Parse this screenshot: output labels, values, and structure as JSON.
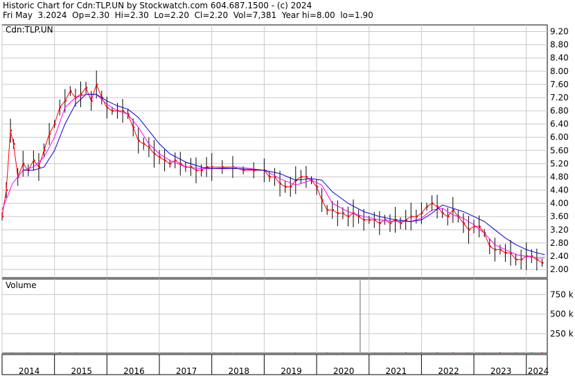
{
  "header": {
    "line1": "Historic Chart for Cdn:TLP.UN by Stockwatch.com 604.687.1500 - (c) 2024",
    "line2": "Fri May  3.2024  Op=2.30  Hi=2.30  Lo=2.20  Cl=2.20  Vol=7,381  Year hi=8.00  lo=1.90"
  },
  "colors": {
    "price_bar": "#000000",
    "price_close_marker": "#ff0000",
    "ma_short": "#ff00ff",
    "ma_long": "#0000cc",
    "volume_up": "#00aa00",
    "volume_down": "#cc0000",
    "volume_spike": "#999999",
    "grid": "#c8c8c8"
  },
  "chart_data": [
    {
      "type": "line",
      "name": "price",
      "title": "Cdn:TLP.UN",
      "xlabel": "",
      "ylabel": "",
      "y_axis_side": "right",
      "ylim": [
        1.75,
        9.4
      ],
      "xlim": [
        2014.0,
        2024.4
      ],
      "grid": true,
      "y_ticks": [
        "9.20",
        "8.80",
        "8.40",
        "8.00",
        "7.60",
        "7.20",
        "6.80",
        "6.40",
        "6.00",
        "5.60",
        "5.20",
        "4.80",
        "4.40",
        "4.00",
        "3.60",
        "3.20",
        "2.80",
        "2.40",
        "2.00"
      ],
      "x_ticks": [
        "2014",
        "2015",
        "2016",
        "2017",
        "2018",
        "2019",
        "2020",
        "2021",
        "2022",
        "2023",
        "2024"
      ],
      "series": [
        {
          "key": "close",
          "x": [
            2014.0,
            2014.08,
            2014.16,
            2014.22,
            2014.3,
            2014.4,
            2014.5,
            2014.6,
            2014.7,
            2014.8,
            2014.9,
            2015.0,
            2015.1,
            2015.2,
            2015.3,
            2015.4,
            2015.5,
            2015.6,
            2015.7,
            2015.8,
            2015.9,
            2016.0,
            2016.1,
            2016.2,
            2016.3,
            2016.4,
            2016.5,
            2016.6,
            2016.7,
            2016.8,
            2016.9,
            2017.0,
            2017.1,
            2017.2,
            2017.3,
            2017.4,
            2017.5,
            2017.6,
            2017.7,
            2017.8,
            2017.9,
            2018.0,
            2018.2,
            2018.4,
            2018.6,
            2018.8,
            2019.0,
            2019.1,
            2019.2,
            2019.3,
            2019.4,
            2019.5,
            2019.6,
            2019.7,
            2019.8,
            2019.9,
            2020.0,
            2020.1,
            2020.2,
            2020.3,
            2020.4,
            2020.5,
            2020.6,
            2020.7,
            2020.8,
            2020.9,
            2021.0,
            2021.1,
            2021.2,
            2021.3,
            2021.4,
            2021.5,
            2021.6,
            2021.7,
            2021.8,
            2021.9,
            2022.0,
            2022.1,
            2022.2,
            2022.3,
            2022.4,
            2022.5,
            2022.6,
            2022.7,
            2022.8,
            2022.9,
            2023.0,
            2023.1,
            2023.2,
            2023.3,
            2023.4,
            2023.5,
            2023.6,
            2023.7,
            2023.8,
            2023.9,
            2024.0,
            2024.1,
            2024.2,
            2024.3
          ],
          "y": [
            3.6,
            4.4,
            6.2,
            5.8,
            4.8,
            5.2,
            5.0,
            5.3,
            5.1,
            5.6,
            6.1,
            6.4,
            6.9,
            7.1,
            7.4,
            7.2,
            7.3,
            7.5,
            7.1,
            7.6,
            7.2,
            6.9,
            6.8,
            6.8,
            6.8,
            6.7,
            6.3,
            5.9,
            5.8,
            5.7,
            5.5,
            5.4,
            5.3,
            5.2,
            5.3,
            5.2,
            5.1,
            5.1,
            5.0,
            5.0,
            5.1,
            5.1,
            5.1,
            5.1,
            5.0,
            5.0,
            5.0,
            4.8,
            4.8,
            4.6,
            4.5,
            4.5,
            4.7,
            4.8,
            4.8,
            4.7,
            4.5,
            4.1,
            3.8,
            3.8,
            3.7,
            3.7,
            3.6,
            3.7,
            3.6,
            3.5,
            3.5,
            3.5,
            3.4,
            3.5,
            3.4,
            3.5,
            3.4,
            3.5,
            3.6,
            3.6,
            3.7,
            3.9,
            4.0,
            3.9,
            3.7,
            3.6,
            3.8,
            3.6,
            3.4,
            3.2,
            3.3,
            3.3,
            3.1,
            2.7,
            2.6,
            2.6,
            2.5,
            2.5,
            2.3,
            2.3,
            2.4,
            2.4,
            2.3,
            2.2
          ]
        },
        {
          "key": "ma_short",
          "x": [
            2014.0,
            2014.2,
            2014.4,
            2014.6,
            2014.8,
            2015.0,
            2015.2,
            2015.4,
            2015.6,
            2015.8,
            2016.0,
            2016.2,
            2016.4,
            2016.6,
            2016.8,
            2017.0,
            2017.2,
            2017.5,
            2017.8,
            2018.0,
            2018.5,
            2019.0,
            2019.3,
            2019.6,
            2019.9,
            2020.1,
            2020.3,
            2020.6,
            2020.9,
            2021.2,
            2021.5,
            2021.8,
            2022.0,
            2022.2,
            2022.4,
            2022.6,
            2022.8,
            2023.0,
            2023.2,
            2023.4,
            2023.6,
            2023.8,
            2024.0,
            2024.2,
            2024.35
          ],
          "y": [
            3.8,
            4.6,
            5.0,
            5.1,
            5.4,
            6.0,
            6.9,
            7.2,
            7.3,
            7.3,
            7.0,
            6.8,
            6.7,
            6.3,
            5.8,
            5.5,
            5.3,
            5.1,
            5.05,
            5.05,
            5.1,
            5.0,
            4.75,
            4.55,
            4.7,
            4.55,
            4.0,
            3.75,
            3.6,
            3.5,
            3.45,
            3.45,
            3.55,
            3.8,
            3.85,
            3.65,
            3.55,
            3.35,
            3.1,
            2.75,
            2.6,
            2.45,
            2.4,
            2.35,
            2.35
          ]
        },
        {
          "key": "ma_long",
          "x": [
            2014.4,
            2014.6,
            2014.8,
            2015.0,
            2015.2,
            2015.4,
            2015.6,
            2015.8,
            2016.0,
            2016.2,
            2016.4,
            2016.6,
            2016.8,
            2017.0,
            2017.2,
            2017.5,
            2017.8,
            2018.0,
            2018.5,
            2019.0,
            2019.3,
            2019.6,
            2019.9,
            2020.1,
            2020.3,
            2020.6,
            2020.9,
            2021.2,
            2021.5,
            2021.8,
            2022.0,
            2022.2,
            2022.4,
            2022.6,
            2022.8,
            2023.0,
            2023.2,
            2023.4,
            2023.6,
            2023.8,
            2024.0,
            2024.2,
            2024.35
          ],
          "y": [
            5.0,
            5.0,
            5.1,
            5.6,
            6.4,
            7.0,
            7.3,
            7.3,
            7.1,
            6.95,
            6.85,
            6.6,
            6.2,
            5.8,
            5.5,
            5.25,
            5.1,
            5.05,
            5.05,
            5.0,
            4.9,
            4.7,
            4.75,
            4.7,
            4.35,
            4.0,
            3.75,
            3.6,
            3.5,
            3.45,
            3.5,
            3.7,
            3.95,
            3.85,
            3.75,
            3.6,
            3.45,
            3.2,
            2.95,
            2.75,
            2.6,
            2.5,
            2.45
          ]
        }
      ]
    },
    {
      "type": "bar",
      "name": "volume",
      "title": "Volume",
      "xlabel": "",
      "ylabel": "",
      "y_axis_side": "right",
      "ylim": [
        0,
        950000
      ],
      "y_ticks": [
        "750 k",
        "500 k",
        "250 k"
      ],
      "baseline_note": "",
      "spike": {
        "x": 2020.83,
        "value": 935000
      },
      "x": [
        2014.2,
        2014.5,
        2014.8,
        2015.1,
        2015.4,
        2015.7,
        2016.0,
        2016.3,
        2016.6,
        2016.9,
        2017.2,
        2017.5,
        2017.8,
        2018.1,
        2018.4,
        2018.7,
        2019.0,
        2019.3,
        2019.6,
        2019.9,
        2020.2,
        2020.5,
        2021.1,
        2021.4,
        2021.7,
        2022.0,
        2022.3,
        2022.6,
        2022.9,
        2023.2,
        2023.5,
        2023.8,
        2024.1,
        2024.3
      ],
      "values": [
        9000,
        11000,
        8000,
        15000,
        12000,
        9000,
        7000,
        8000,
        6000,
        7000,
        6000,
        5000,
        6000,
        5000,
        4000,
        5000,
        6000,
        7000,
        9000,
        8000,
        12000,
        9000,
        11000,
        10000,
        13000,
        17000,
        15000,
        12000,
        11000,
        10000,
        14000,
        12000,
        15000,
        13000
      ]
    }
  ]
}
